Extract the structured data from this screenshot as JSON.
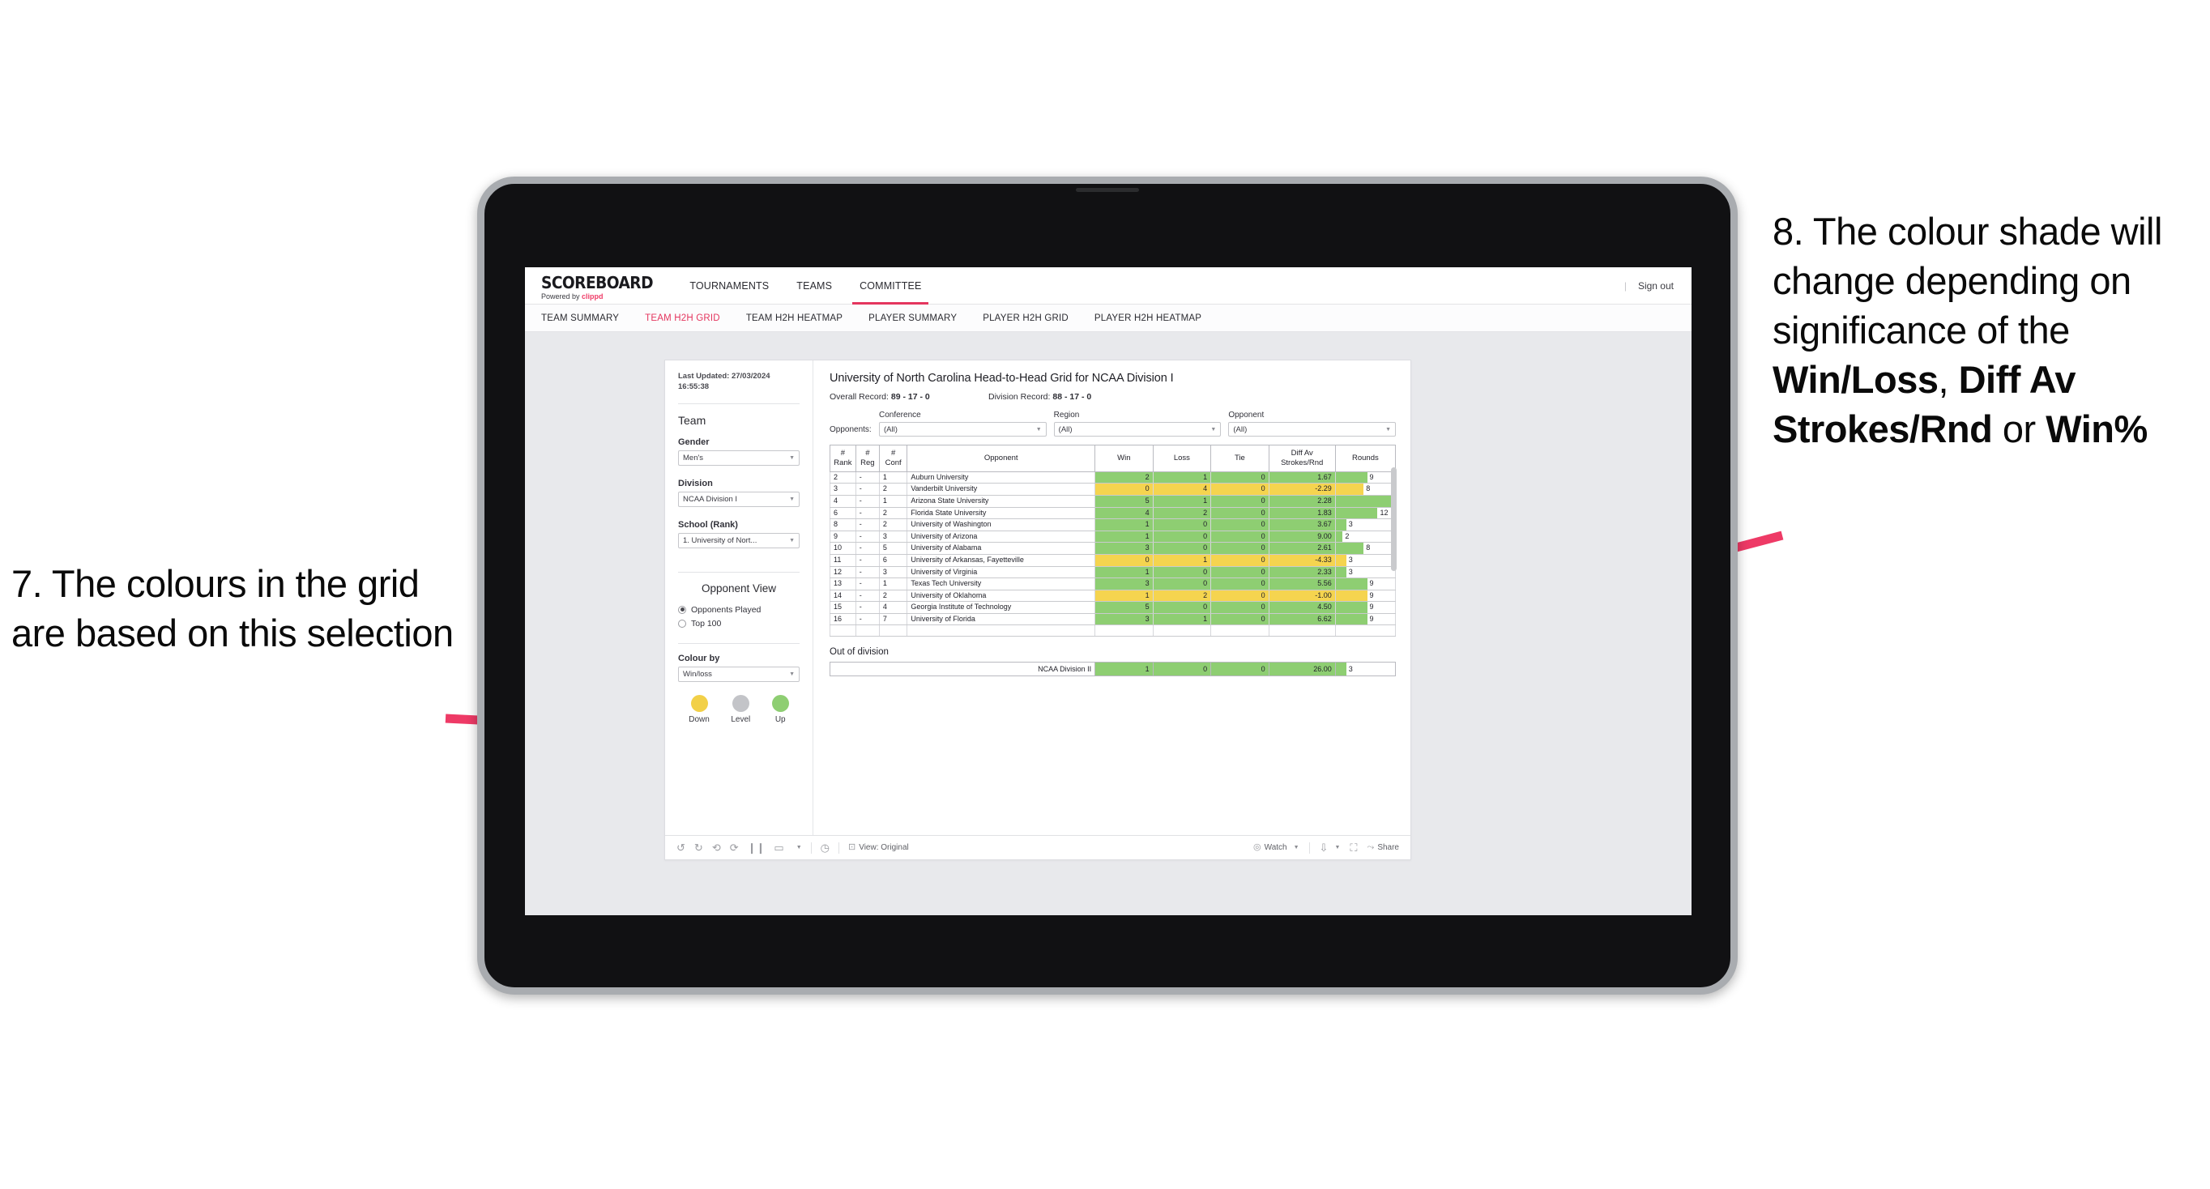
{
  "annotations": {
    "left": "7. The colours in the grid are based on this selection",
    "right_parts": [
      {
        "text": "8. The colour shade will change depending on significance of the ",
        "bold": false
      },
      {
        "text": "Win/Loss",
        "bold": true
      },
      {
        "text": ", ",
        "bold": false
      },
      {
        "text": "Diff Av Strokes/Rnd",
        "bold": true
      },
      {
        "text": " or ",
        "bold": false
      },
      {
        "text": "Win%",
        "bold": true
      }
    ],
    "arrow_color": "#ee3a66"
  },
  "app": {
    "brand": {
      "title": "SCOREBOARD",
      "powered_prefix": "Powered by ",
      "powered_name": "clippd"
    },
    "topnav": [
      {
        "label": "TOURNAMENTS",
        "active": false
      },
      {
        "label": "TEAMS",
        "active": false
      },
      {
        "label": "COMMITTEE",
        "active": true
      }
    ],
    "signout": {
      "divider": "|",
      "label": "Sign out"
    },
    "subnav": [
      {
        "label": "TEAM SUMMARY",
        "active": false
      },
      {
        "label": "TEAM H2H GRID",
        "active": true
      },
      {
        "label": "TEAM H2H HEATMAP",
        "active": false
      },
      {
        "label": "PLAYER SUMMARY",
        "active": false
      },
      {
        "label": "PLAYER H2H GRID",
        "active": false
      },
      {
        "label": "PLAYER H2H HEATMAP",
        "active": false
      }
    ],
    "accent": "#e4355e"
  },
  "pane": {
    "last_updated": "Last Updated: 27/03/2024 16:55:38",
    "team_heading": "Team",
    "gender": {
      "label": "Gender",
      "value": "Men's"
    },
    "division": {
      "label": "Division",
      "value": "NCAA Division I"
    },
    "school": {
      "label": "School (Rank)",
      "value": "1. University of Nort..."
    },
    "opponent_view": {
      "heading": "Opponent View",
      "options": [
        {
          "label": "Opponents Played",
          "selected": true
        },
        {
          "label": "Top 100",
          "selected": false
        }
      ]
    },
    "colour_by": {
      "label": "Colour by",
      "value": "Win/loss"
    },
    "legend": [
      {
        "label": "Down",
        "color": "#f2d048"
      },
      {
        "label": "Level",
        "color": "#c3c4c8"
      },
      {
        "label": "Up",
        "color": "#8ece72"
      }
    ]
  },
  "content": {
    "title": "University of North Carolina Head-to-Head Grid for NCAA Division I",
    "overall_record_label": "Overall Record: ",
    "overall_record_value": "89 - 17 - 0",
    "division_record_label": "Division Record: ",
    "division_record_value": "88 - 17 - 0",
    "opponents_label": "Opponents:",
    "filters": [
      {
        "label": "Conference",
        "value": "(All)"
      },
      {
        "label": "Region",
        "value": "(All)"
      },
      {
        "label": "Opponent",
        "value": "(All)"
      }
    ],
    "out_of_division_title": "Out of division"
  },
  "chart_data": {
    "type": "table",
    "title": "University of North Carolina Head-to-Head Grid for NCAA Division I",
    "columns": [
      "# Rank",
      "# Reg",
      "# Conf",
      "Opponent",
      "Win",
      "Loss",
      "Tie",
      "Diff Av Strokes/Rnd",
      "Rounds"
    ],
    "column_headers_multiline": [
      [
        "#",
        "Rank"
      ],
      [
        "#",
        "Reg"
      ],
      [
        "#",
        "Conf"
      ],
      [
        "Opponent"
      ],
      [
        "Win"
      ],
      [
        "Loss"
      ],
      [
        "Tie"
      ],
      [
        "Diff Av",
        "Strokes/Rnd"
      ],
      [
        "Rounds"
      ]
    ],
    "rounds_max": 17,
    "colors": {
      "up": "#8ece72",
      "down": "#f5d44f",
      "level": "#c3c4c8"
    },
    "rows": [
      {
        "rank": "2",
        "reg": "-",
        "conf": "1",
        "opponent": "Auburn University",
        "win": "2",
        "loss": "1",
        "tie": "0",
        "diff": "1.67",
        "rounds": "9",
        "color": "up"
      },
      {
        "rank": "3",
        "reg": "-",
        "conf": "2",
        "opponent": "Vanderbilt University",
        "win": "0",
        "loss": "4",
        "tie": "0",
        "diff": "-2.29",
        "rounds": "8",
        "color": "down"
      },
      {
        "rank": "4",
        "reg": "-",
        "conf": "1",
        "opponent": "Arizona State University",
        "win": "5",
        "loss": "1",
        "tie": "0",
        "diff": "2.28",
        "rounds": "17",
        "color": "up"
      },
      {
        "rank": "6",
        "reg": "-",
        "conf": "2",
        "opponent": "Florida State University",
        "win": "4",
        "loss": "2",
        "tie": "0",
        "diff": "1.83",
        "rounds": "12",
        "color": "up"
      },
      {
        "rank": "8",
        "reg": "-",
        "conf": "2",
        "opponent": "University of Washington",
        "win": "1",
        "loss": "0",
        "tie": "0",
        "diff": "3.67",
        "rounds": "3",
        "color": "up"
      },
      {
        "rank": "9",
        "reg": "-",
        "conf": "3",
        "opponent": "University of Arizona",
        "win": "1",
        "loss": "0",
        "tie": "0",
        "diff": "9.00",
        "rounds": "2",
        "color": "up"
      },
      {
        "rank": "10",
        "reg": "-",
        "conf": "5",
        "opponent": "University of Alabama",
        "win": "3",
        "loss": "0",
        "tie": "0",
        "diff": "2.61",
        "rounds": "8",
        "color": "up"
      },
      {
        "rank": "11",
        "reg": "-",
        "conf": "6",
        "opponent": "University of Arkansas, Fayetteville",
        "win": "0",
        "loss": "1",
        "tie": "0",
        "diff": "-4.33",
        "rounds": "3",
        "color": "down"
      },
      {
        "rank": "12",
        "reg": "-",
        "conf": "3",
        "opponent": "University of Virginia",
        "win": "1",
        "loss": "0",
        "tie": "0",
        "diff": "2.33",
        "rounds": "3",
        "color": "up"
      },
      {
        "rank": "13",
        "reg": "-",
        "conf": "1",
        "opponent": "Texas Tech University",
        "win": "3",
        "loss": "0",
        "tie": "0",
        "diff": "5.56",
        "rounds": "9",
        "color": "up"
      },
      {
        "rank": "14",
        "reg": "-",
        "conf": "2",
        "opponent": "University of Oklahoma",
        "win": "1",
        "loss": "2",
        "tie": "0",
        "diff": "-1.00",
        "rounds": "9",
        "color": "down"
      },
      {
        "rank": "15",
        "reg": "-",
        "conf": "4",
        "opponent": "Georgia Institute of Technology",
        "win": "5",
        "loss": "0",
        "tie": "0",
        "diff": "4.50",
        "rounds": "9",
        "color": "up"
      },
      {
        "rank": "16",
        "reg": "-",
        "conf": "7",
        "opponent": "University of Florida",
        "win": "3",
        "loss": "1",
        "tie": "0",
        "diff": "6.62",
        "rounds": "9",
        "color": "up"
      }
    ],
    "out_of_division": [
      {
        "label": "NCAA Division II",
        "win": "1",
        "loss": "0",
        "tie": "0",
        "diff": "26.00",
        "rounds": "3",
        "color": "up"
      }
    ]
  },
  "toolbar": {
    "view_label": "View: Original",
    "watch_label": "Watch",
    "share_label": "Share"
  }
}
